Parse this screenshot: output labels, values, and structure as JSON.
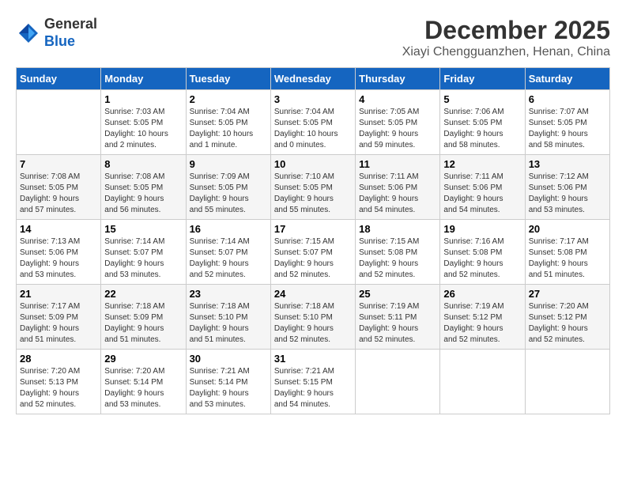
{
  "header": {
    "logo": {
      "line1": "General",
      "line2": "Blue"
    },
    "month": "December 2025",
    "location": "Xiayi Chengguanzhen, Henan, China"
  },
  "weekdays": [
    "Sunday",
    "Monday",
    "Tuesday",
    "Wednesday",
    "Thursday",
    "Friday",
    "Saturday"
  ],
  "weeks": [
    [
      {
        "day": "",
        "info": ""
      },
      {
        "day": "1",
        "info": "Sunrise: 7:03 AM\nSunset: 5:05 PM\nDaylight: 10 hours\nand 2 minutes."
      },
      {
        "day": "2",
        "info": "Sunrise: 7:04 AM\nSunset: 5:05 PM\nDaylight: 10 hours\nand 1 minute."
      },
      {
        "day": "3",
        "info": "Sunrise: 7:04 AM\nSunset: 5:05 PM\nDaylight: 10 hours\nand 0 minutes."
      },
      {
        "day": "4",
        "info": "Sunrise: 7:05 AM\nSunset: 5:05 PM\nDaylight: 9 hours\nand 59 minutes."
      },
      {
        "day": "5",
        "info": "Sunrise: 7:06 AM\nSunset: 5:05 PM\nDaylight: 9 hours\nand 58 minutes."
      },
      {
        "day": "6",
        "info": "Sunrise: 7:07 AM\nSunset: 5:05 PM\nDaylight: 9 hours\nand 58 minutes."
      }
    ],
    [
      {
        "day": "7",
        "info": "Sunrise: 7:08 AM\nSunset: 5:05 PM\nDaylight: 9 hours\nand 57 minutes."
      },
      {
        "day": "8",
        "info": "Sunrise: 7:08 AM\nSunset: 5:05 PM\nDaylight: 9 hours\nand 56 minutes."
      },
      {
        "day": "9",
        "info": "Sunrise: 7:09 AM\nSunset: 5:05 PM\nDaylight: 9 hours\nand 55 minutes."
      },
      {
        "day": "10",
        "info": "Sunrise: 7:10 AM\nSunset: 5:05 PM\nDaylight: 9 hours\nand 55 minutes."
      },
      {
        "day": "11",
        "info": "Sunrise: 7:11 AM\nSunset: 5:06 PM\nDaylight: 9 hours\nand 54 minutes."
      },
      {
        "day": "12",
        "info": "Sunrise: 7:11 AM\nSunset: 5:06 PM\nDaylight: 9 hours\nand 54 minutes."
      },
      {
        "day": "13",
        "info": "Sunrise: 7:12 AM\nSunset: 5:06 PM\nDaylight: 9 hours\nand 53 minutes."
      }
    ],
    [
      {
        "day": "14",
        "info": "Sunrise: 7:13 AM\nSunset: 5:06 PM\nDaylight: 9 hours\nand 53 minutes."
      },
      {
        "day": "15",
        "info": "Sunrise: 7:14 AM\nSunset: 5:07 PM\nDaylight: 9 hours\nand 53 minutes."
      },
      {
        "day": "16",
        "info": "Sunrise: 7:14 AM\nSunset: 5:07 PM\nDaylight: 9 hours\nand 52 minutes."
      },
      {
        "day": "17",
        "info": "Sunrise: 7:15 AM\nSunset: 5:07 PM\nDaylight: 9 hours\nand 52 minutes."
      },
      {
        "day": "18",
        "info": "Sunrise: 7:15 AM\nSunset: 5:08 PM\nDaylight: 9 hours\nand 52 minutes."
      },
      {
        "day": "19",
        "info": "Sunrise: 7:16 AM\nSunset: 5:08 PM\nDaylight: 9 hours\nand 52 minutes."
      },
      {
        "day": "20",
        "info": "Sunrise: 7:17 AM\nSunset: 5:08 PM\nDaylight: 9 hours\nand 51 minutes."
      }
    ],
    [
      {
        "day": "21",
        "info": "Sunrise: 7:17 AM\nSunset: 5:09 PM\nDaylight: 9 hours\nand 51 minutes."
      },
      {
        "day": "22",
        "info": "Sunrise: 7:18 AM\nSunset: 5:09 PM\nDaylight: 9 hours\nand 51 minutes."
      },
      {
        "day": "23",
        "info": "Sunrise: 7:18 AM\nSunset: 5:10 PM\nDaylight: 9 hours\nand 51 minutes."
      },
      {
        "day": "24",
        "info": "Sunrise: 7:18 AM\nSunset: 5:10 PM\nDaylight: 9 hours\nand 52 minutes."
      },
      {
        "day": "25",
        "info": "Sunrise: 7:19 AM\nSunset: 5:11 PM\nDaylight: 9 hours\nand 52 minutes."
      },
      {
        "day": "26",
        "info": "Sunrise: 7:19 AM\nSunset: 5:12 PM\nDaylight: 9 hours\nand 52 minutes."
      },
      {
        "day": "27",
        "info": "Sunrise: 7:20 AM\nSunset: 5:12 PM\nDaylight: 9 hours\nand 52 minutes."
      }
    ],
    [
      {
        "day": "28",
        "info": "Sunrise: 7:20 AM\nSunset: 5:13 PM\nDaylight: 9 hours\nand 52 minutes."
      },
      {
        "day": "29",
        "info": "Sunrise: 7:20 AM\nSunset: 5:14 PM\nDaylight: 9 hours\nand 53 minutes."
      },
      {
        "day": "30",
        "info": "Sunrise: 7:21 AM\nSunset: 5:14 PM\nDaylight: 9 hours\nand 53 minutes."
      },
      {
        "day": "31",
        "info": "Sunrise: 7:21 AM\nSunset: 5:15 PM\nDaylight: 9 hours\nand 54 minutes."
      },
      {
        "day": "",
        "info": ""
      },
      {
        "day": "",
        "info": ""
      },
      {
        "day": "",
        "info": ""
      }
    ]
  ]
}
